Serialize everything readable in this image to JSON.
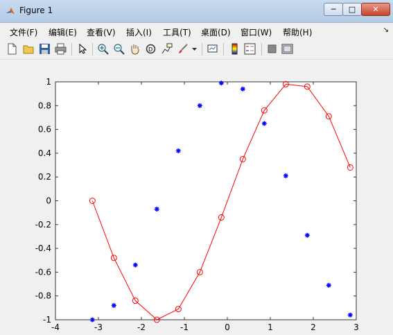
{
  "window": {
    "title": "Figure 1",
    "min_label": "─",
    "max_label": "□",
    "close_label": "✕"
  },
  "menu": [
    "文件(F)",
    "编辑(E)",
    "查看(V)",
    "插入(I)",
    "工具(T)",
    "桌面(D)",
    "窗口(W)",
    "帮助(H)"
  ],
  "menu_overflow": "↘",
  "toolbar": [
    "new-file-icon",
    "open-folder-icon",
    "save-icon",
    "print-icon",
    "pointer-icon",
    "zoom-in-icon",
    "zoom-out-icon",
    "pan-hand-icon",
    "rotate-3d-icon",
    "data-cursor-icon",
    "brush-icon",
    "link-plot-icon",
    "colorbar-icon",
    "legend-icon",
    "hide-plot-tools-icon",
    "show-plot-tools-icon"
  ],
  "chart_data": {
    "type": "line",
    "title": "",
    "xlabel": "",
    "ylabel": "",
    "xlim": [
      -4,
      3
    ],
    "ylim": [
      -1,
      1
    ],
    "xticks": [
      "-4",
      "-3",
      "-2",
      "-1",
      "0",
      "1",
      "2",
      "3"
    ],
    "yticks": [
      "-1",
      "-0.8",
      "-0.6",
      "-0.4",
      "-0.2",
      "0",
      "0.2",
      "0.4",
      "0.6",
      "0.8",
      "1"
    ],
    "grid": false,
    "series": [
      {
        "style": "red line with circle markers",
        "color": "#ff0000",
        "x": [
          -3.14,
          -2.64,
          -2.14,
          -1.64,
          -1.14,
          -0.64,
          -0.14,
          0.36,
          0.86,
          1.36,
          1.86,
          2.36,
          2.86
        ],
        "y": [
          0,
          -0.48,
          -0.84,
          -1.0,
          -0.91,
          -0.6,
          -0.14,
          0.35,
          0.76,
          0.98,
          0.96,
          0.71,
          0.28
        ]
      },
      {
        "style": "blue asterisk markers",
        "color": "#0000ff",
        "x": [
          -3.14,
          -2.64,
          -2.14,
          -1.64,
          -1.14,
          -0.64,
          -0.14,
          0.36,
          0.86,
          1.36,
          1.86,
          2.36,
          2.86
        ],
        "y": [
          -1.0,
          -0.88,
          -0.54,
          -0.07,
          0.42,
          0.8,
          0.99,
          0.94,
          0.65,
          0.21,
          -0.29,
          -0.71,
          -0.96
        ]
      }
    ]
  }
}
